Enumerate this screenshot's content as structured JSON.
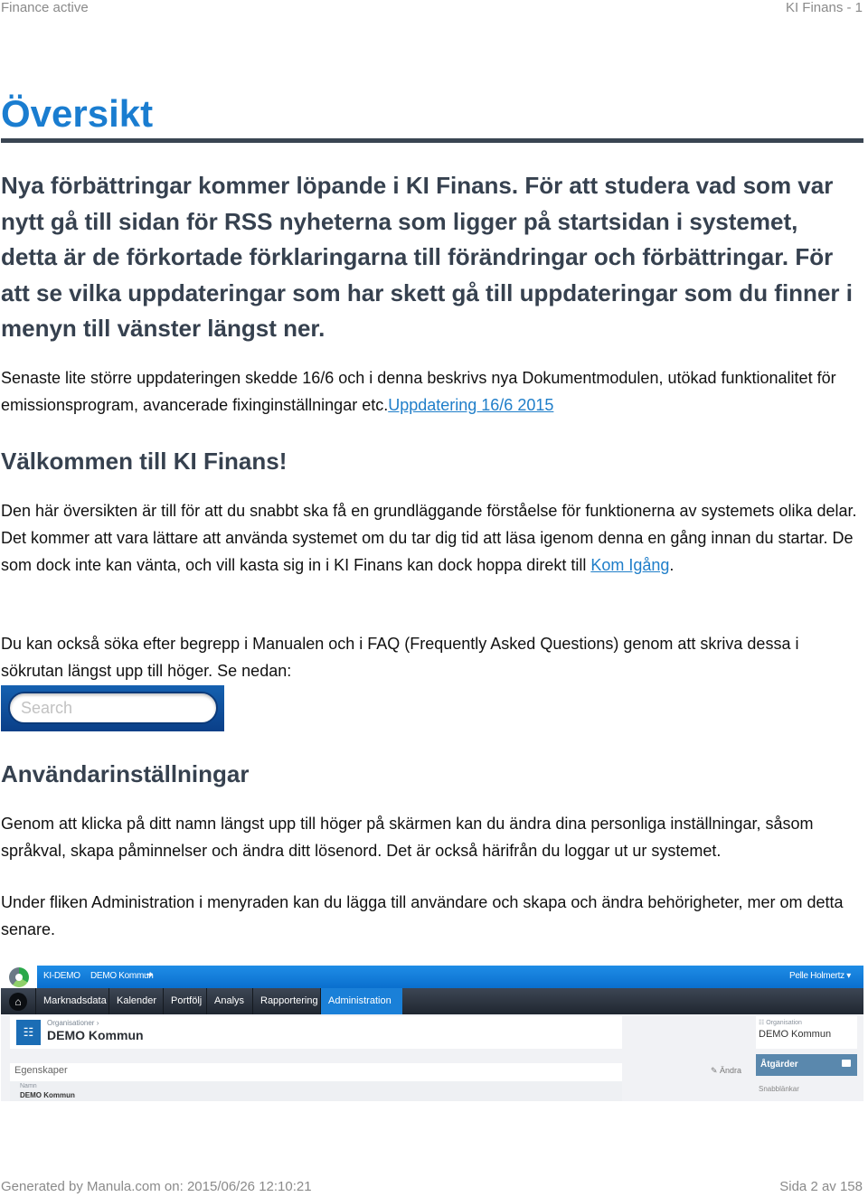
{
  "running_header": {
    "left": "Finance active",
    "right": "KI Finans - 1"
  },
  "page_title": "Översikt",
  "intro": {
    "text": "Nya förbättringar kommer löpande i KI Finans. För att studera vad som var nytt gå till sidan för RSS nyheterna som ligger på startsidan i systemet, detta är de förkortade förklaringarna till förändringar och förbättringar. För att se vilka uppdateringar som har skett gå till uppdateringar som du finner i menyn till vänster längst ner."
  },
  "latest_update": {
    "text": "Senaste lite större uppdateringen skedde 16/6 och i denna beskrivs nya Dokumentmodulen, utökad funktionalitet för emissionsprogram, avancerade fixinginställningar etc.",
    "link_label": "Uppdatering 16/6 2015"
  },
  "welcome": {
    "heading": "Välkommen till KI Finans!",
    "paragraph_text": "Den här översikten är till för att du snabbt ska få en grundläggande förståelse för funktionerna av systemets olika delar. Det kommer att vara lättare att använda systemet om du tar dig tid att läsa igenom denna en gång innan du startar. De som dock inte kan vänta, och vill kasta sig in i KI Finans kan dock hoppa direkt till ",
    "link_label": "Kom Igång",
    "paragraph_end": ".",
    "search_hint": "Du kan också söka efter begrepp i Manualen och i FAQ (Frequently Asked Questions) genom att skriva dessa i sökrutan längst upp till höger. Se nedan:",
    "search_placeholder": "Search"
  },
  "user_settings": {
    "heading": "Användarinställningar",
    "paragraph_1": "Genom att klicka på ditt namn längst upp till höger på skärmen kan du ändra dina personliga inställningar, såsom språkval, skapa påminnelser och ändra ditt lösenord. Det är också härifrån du loggar ut ur systemet.",
    "paragraph_2": "Under fliken Administration i menyraden kan du lägga till användare och skapa och ändra behörigheter, mer om detta senare."
  },
  "app_screenshot": {
    "topbar": {
      "org_code": "KI-DEMO",
      "org_name": "DEMO Kommun",
      "logout_icon": "logout-icon",
      "user_name": "Pelle Holmertz ▾"
    },
    "nav": {
      "home_icon": "home-icon",
      "items": [
        {
          "label": "Marknadsdata",
          "active": false
        },
        {
          "label": "Kalender",
          "active": false
        },
        {
          "label": "Portfölj",
          "active": false
        },
        {
          "label": "Analys",
          "active": false
        },
        {
          "label": "Rapportering",
          "active": false
        },
        {
          "label": "Administration ▾",
          "active": true
        }
      ]
    },
    "header": {
      "breadcrumb": "Organisationer ›",
      "title": "DEMO Kommun",
      "icon": "org-chart-icon"
    },
    "properties": {
      "heading": "Egenskaper",
      "edit_label": "Ändra",
      "field_label": "Namn",
      "field_value": "DEMO Kommun"
    },
    "sidebar": {
      "org_label": "Organisation",
      "org_value": "DEMO Kommun",
      "actions_label": "Åtgärder",
      "quicklinks_label": "Snabblänkar"
    },
    "colors": {
      "topbar": "#0a6fce",
      "nav": "#2a313b",
      "active_tab": "#1a80d8",
      "actions_panel": "#5a88ad"
    }
  },
  "running_footer": {
    "left": "Generated by Manula.com on: 2015/06/26 12:10:21",
    "right": "Sida 2 av 158"
  }
}
